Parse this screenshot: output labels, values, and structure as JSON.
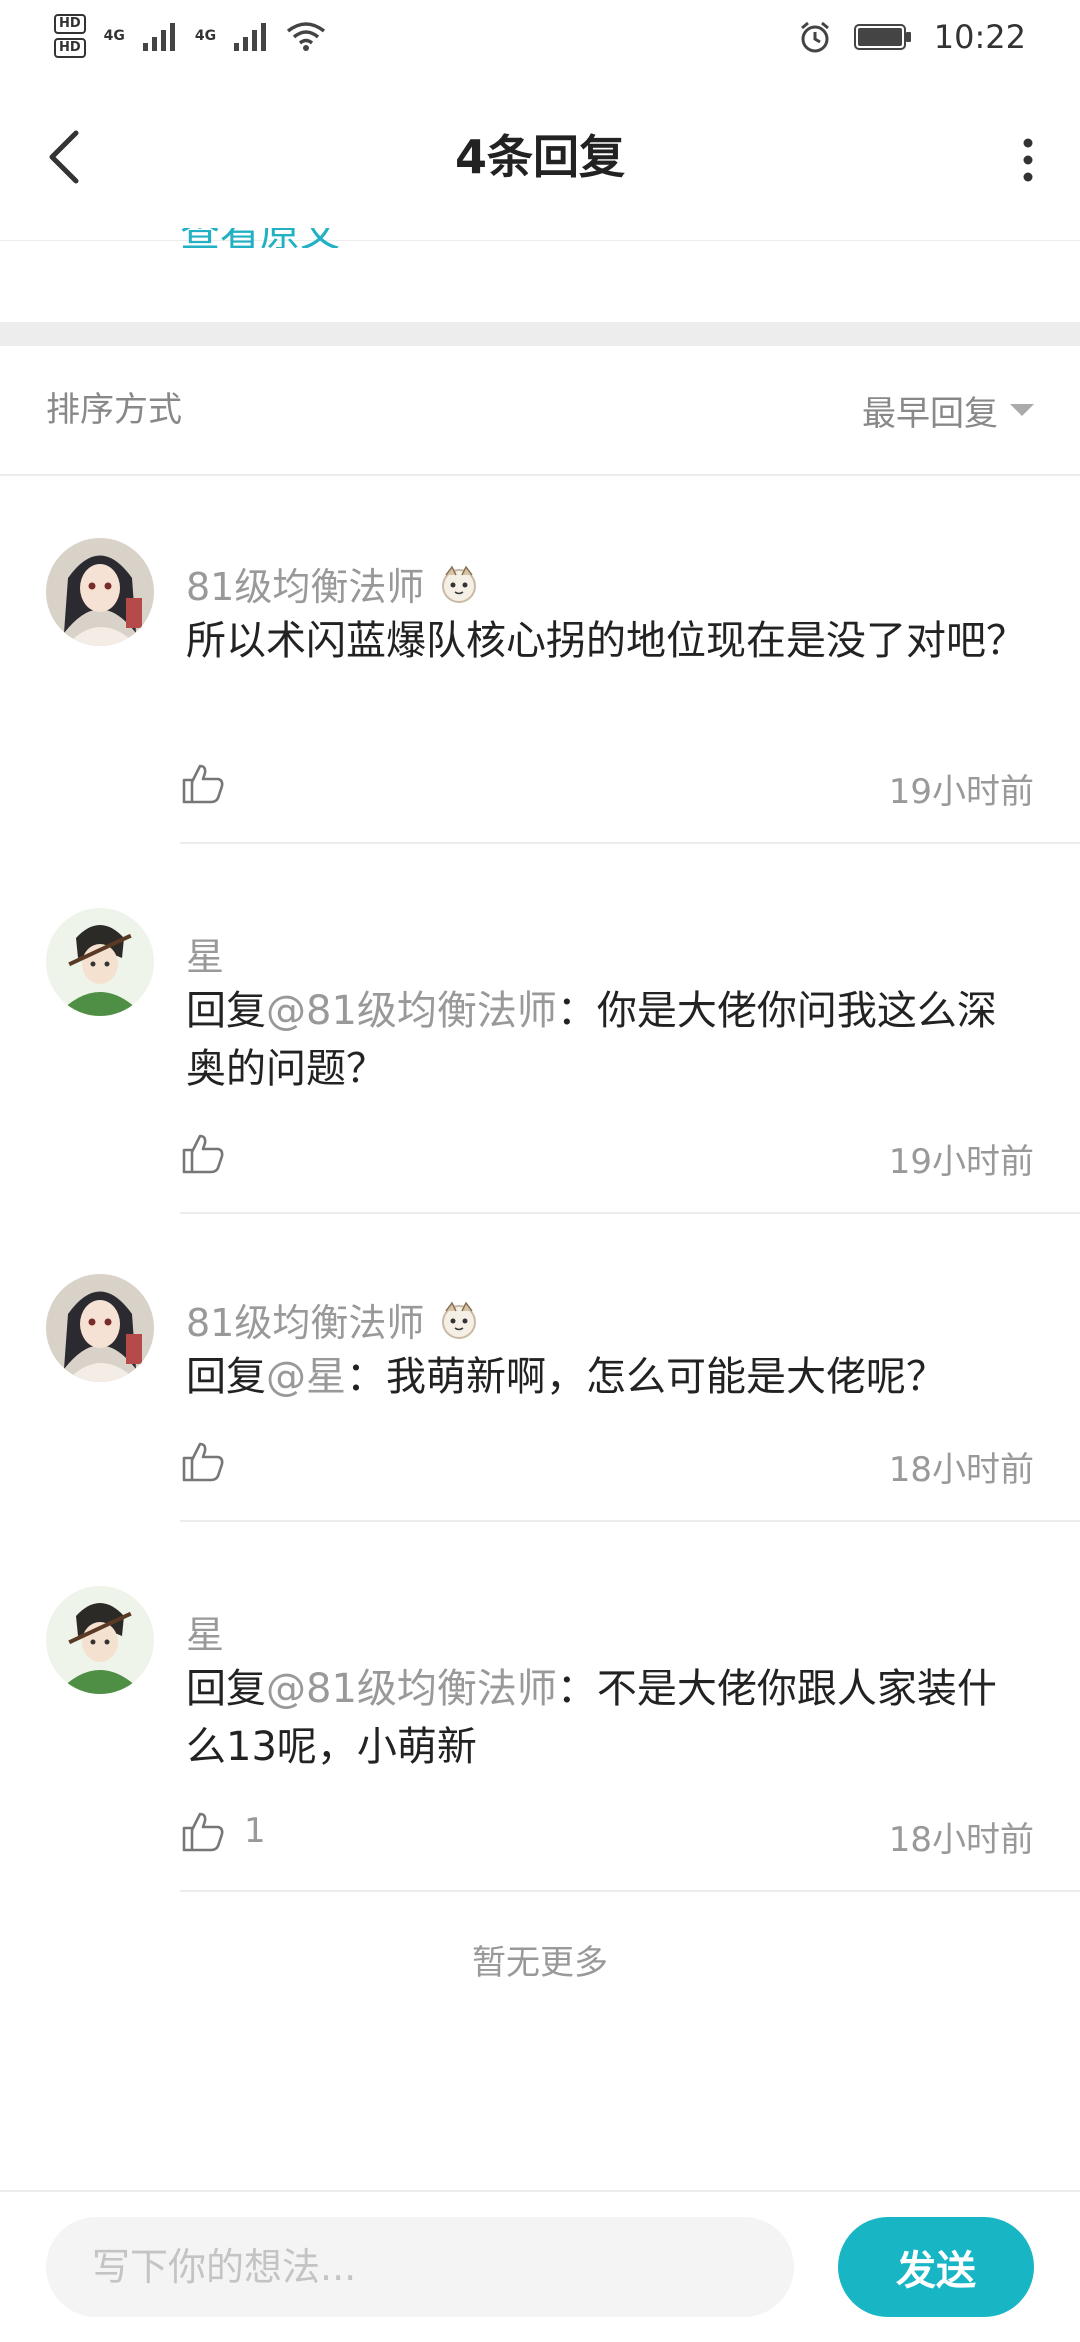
{
  "status_bar": {
    "hd_badges": [
      "HD",
      "HD"
    ],
    "network_labels": [
      "4G",
      "4G"
    ],
    "time": "10:22"
  },
  "header": {
    "title": "4条回复"
  },
  "original_link": {
    "label": "查看原文"
  },
  "sort": {
    "label": "排序方式",
    "value": "最早回复"
  },
  "comments": [
    {
      "username": "81级均衡法师",
      "has_badge": true,
      "mention": "",
      "text": "所以术闪蓝爆队核心拐的地位现在是没了对吧？",
      "likes": "",
      "time": "19小时前"
    },
    {
      "username": "星",
      "has_badge": false,
      "reply_prefix": "回复",
      "mention": "@81级均衡法师",
      "text": "：你是大佬你问我这么深奥的问题？",
      "likes": "",
      "time": "19小时前"
    },
    {
      "username": "81级均衡法师",
      "has_badge": true,
      "reply_prefix": "回复",
      "mention": "@星",
      "text": "：我萌新啊，怎么可能是大佬呢？",
      "likes": "",
      "time": "18小时前"
    },
    {
      "username": "星",
      "has_badge": false,
      "reply_prefix": "回复",
      "mention": "@81级均衡法师",
      "text": "：不是大佬你跟人家装什么13呢，小萌新",
      "likes": "1",
      "time": "18小时前"
    }
  ],
  "end_text": "暂无更多",
  "composer": {
    "placeholder": "写下你的想法...",
    "send_label": "发送"
  },
  "colors": {
    "accent": "#18b5c5",
    "muted_text": "#999999",
    "primary_text": "#222222",
    "divider": "#ececec"
  },
  "icons": [
    "back-arrow-icon",
    "more-vertical-icon",
    "thumbs-up-icon",
    "caret-down-icon",
    "alarm-icon",
    "battery-icon",
    "wifi-icon",
    "signal-icon"
  ]
}
